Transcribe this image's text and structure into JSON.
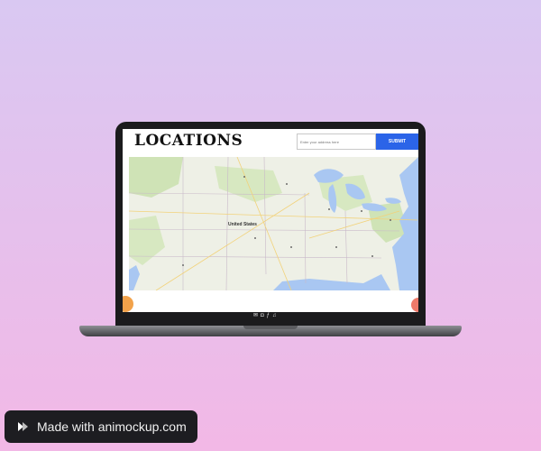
{
  "site": {
    "title": "LOCATIONS",
    "search_placeholder": "Enter your address here",
    "submit_label": "SUBMIT"
  },
  "map": {
    "country_label": "United States",
    "land_color": "#eef0e6",
    "water_color": "#a9c7f2",
    "forest_color": "#cfe3b6"
  },
  "footer": {
    "icons": [
      "mail-icon",
      "instagram-icon",
      "facebook-icon",
      "twitter-icon"
    ]
  },
  "badge": {
    "text": "Made with animockup.com"
  },
  "colors": {
    "background_top": "#d9c8f2",
    "background_bottom": "#f2b8e6",
    "accent": "#2b64e8"
  }
}
